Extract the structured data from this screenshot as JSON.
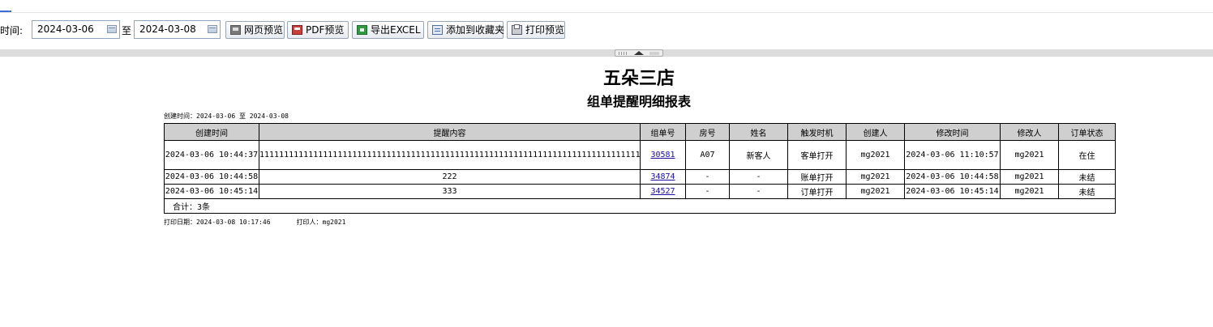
{
  "toolbar": {
    "time_label": "时间:",
    "start_date": "2024-03-06",
    "to_label": "至",
    "end_date": "2024-03-08",
    "buttons": {
      "web_preview": "网页预览",
      "pdf_preview": "PDF预览",
      "export_excel": "导出EXCEL",
      "add_favorite": "添加到收藏夹",
      "print_preview": "打印预览"
    }
  },
  "report": {
    "store_name": "五朵三店",
    "title": "组单提醒明细报表",
    "created_range": "创建时间：2024-03-06 至 2024-03-08",
    "columns": [
      "创建时间",
      "提醒内容",
      "组单号",
      "房号",
      "姓名",
      "触发时机",
      "创建人",
      "修改时间",
      "修改人",
      "订单状态"
    ],
    "rows": [
      {
        "created_time": "2024-03-06 10:44:37",
        "content": "11111111111111111111111111111111111111111111111111111111111111111111111111111111111111111111111",
        "group_no": "30581",
        "room": "A07",
        "name": "新客人",
        "trigger": "客单打开",
        "creator": "mg2021",
        "modified_time": "2024-03-06 11:10:57",
        "modifier": "mg2021",
        "status": "在住"
      },
      {
        "created_time": "2024-03-06 10:44:58",
        "content": "222",
        "group_no": "34874",
        "room": "-",
        "name": "-",
        "trigger": "账单打开",
        "creator": "mg2021",
        "modified_time": "2024-03-06 10:44:58",
        "modifier": "mg2021",
        "status": "未结"
      },
      {
        "created_time": "2024-03-06 10:45:14",
        "content": "333",
        "group_no": "34527",
        "room": "-",
        "name": "-",
        "trigger": "订单打开",
        "creator": "mg2021",
        "modified_time": "2024-03-06 10:45:14",
        "modifier": "mg2021",
        "status": "未结"
      }
    ],
    "total": "合计：3条",
    "print_date": "打印日期：2024-03-08 10:17:46",
    "printer": "打印人：mg2021"
  }
}
